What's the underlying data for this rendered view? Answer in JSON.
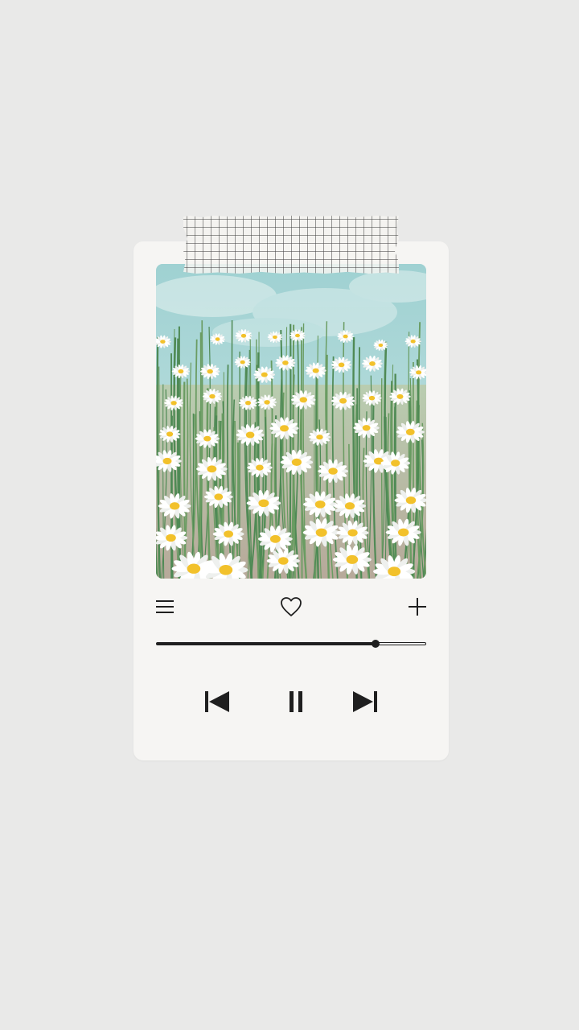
{
  "player": {
    "progress": 0.81,
    "liked": false
  },
  "icons": {
    "menu": "menu-icon",
    "like": "heart-icon",
    "add": "plus-icon",
    "previous": "skip-previous-icon",
    "pause": "pause-icon",
    "next": "skip-next-icon"
  },
  "colors": {
    "background": "#e9e9e8",
    "card": "#f6f5f3",
    "ink": "#1f1f1f",
    "sky": "#a8d6d6",
    "stem": "#4f8a55",
    "petal": "#ffffff",
    "center": "#f2c12b"
  }
}
